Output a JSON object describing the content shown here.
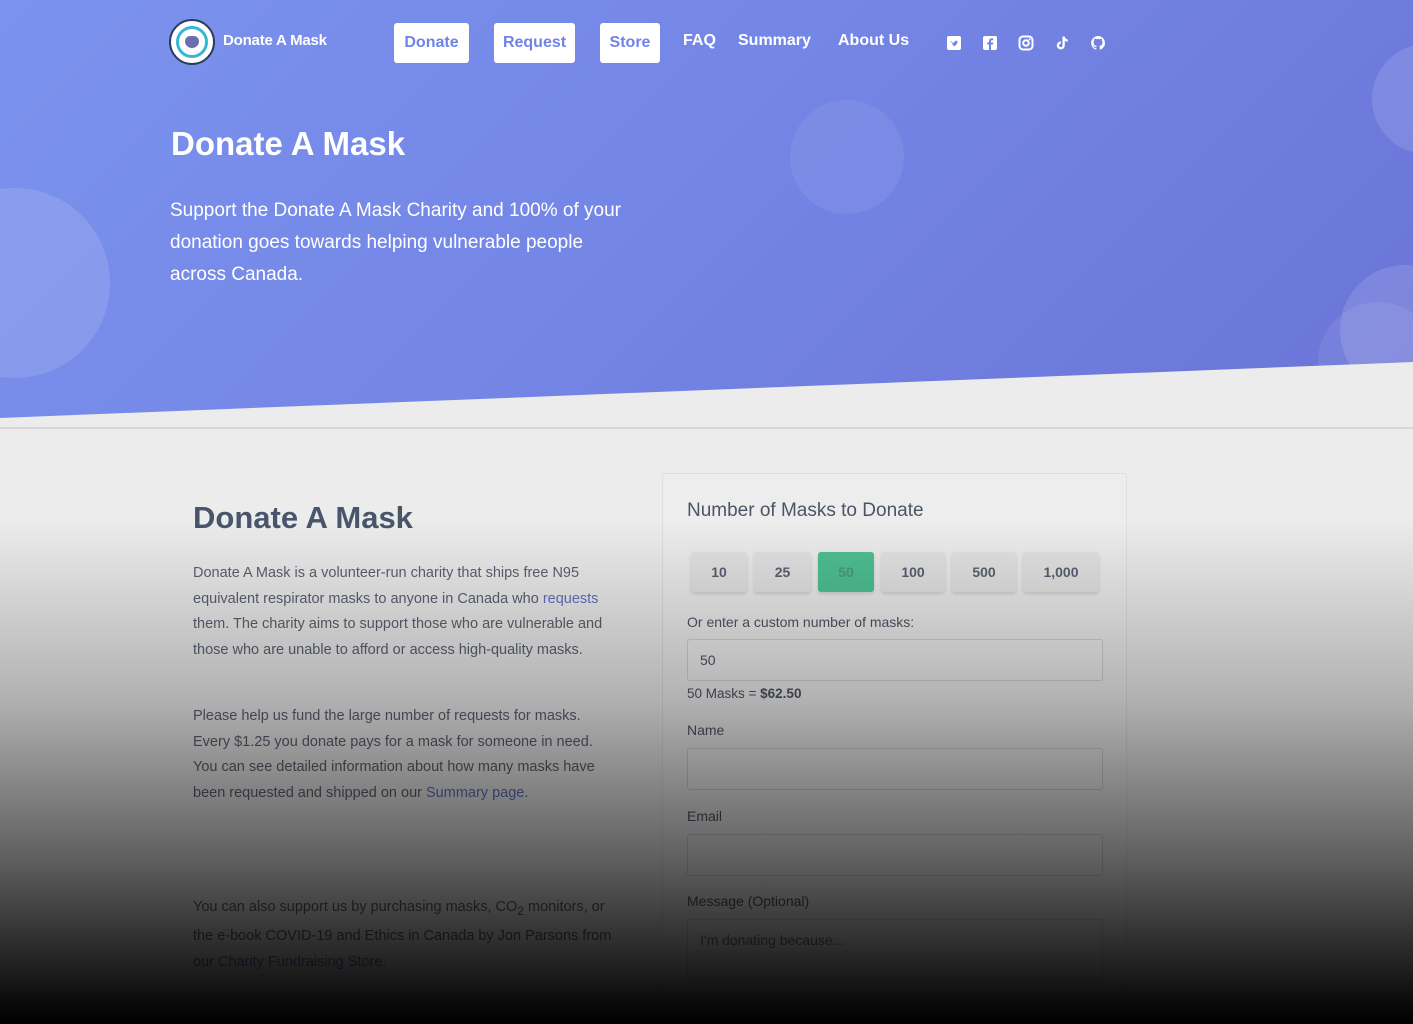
{
  "nav": {
    "brand": "Donate A Mask",
    "buttons": [
      "Donate",
      "Request",
      "Store"
    ],
    "links": [
      "FAQ",
      "Summary",
      "About Us"
    ],
    "social_icons": [
      "twitter-icon",
      "facebook-icon",
      "instagram-icon",
      "tiktok-icon",
      "github-icon"
    ]
  },
  "hero": {
    "title": "Donate A Mask",
    "subtitle": "Support the Donate A Mask Charity and 100% of your donation goes towards helping vulnerable people across Canada."
  },
  "content": {
    "title": "Donate A Mask",
    "p1_before": "Donate A Mask is a volunteer-run charity that ships free N95 equivalent respirator masks to anyone in Canada who ",
    "p1_link": "requests",
    "p1_after": " them. The charity aims to support those who are vulnerable and those who are unable to afford or access high-quality masks.",
    "p2_before": "Please help us fund the large number of requests for masks. Every $1.25 you donate pays for a mask for someone in need. You can see detailed information about how many masks have been requested and shipped on our ",
    "p2_link": "Summary page",
    "p2_after": ".",
    "p3_before": "You can also support us by purchasing masks, CO",
    "p3_sub": "2",
    "p3_mid": " monitors, or the e-book COVID-19 and Ethics in Canada by Jon Parsons from our ",
    "p3_link": "Charity Fundraising Store",
    "p3_after": "."
  },
  "form": {
    "title": "Number of Masks to Donate",
    "quantities": [
      "10",
      "25",
      "50",
      "100",
      "500",
      "1,000"
    ],
    "selected": "50",
    "custom_label": "Or enter a custom number of masks:",
    "custom_value": "50",
    "calc_prefix": "50 Masks = ",
    "calc_total": "$62.50",
    "name_label": "Name",
    "email_label": "Email",
    "message_label": "Message (Optional)",
    "message_placeholder": "I'm donating because..."
  },
  "colors": {
    "hero_gradient_start": "#7b93ee",
    "hero_gradient_end": "#6a74d6",
    "selected_qty": "#4fc092",
    "link": "#6171c4"
  }
}
